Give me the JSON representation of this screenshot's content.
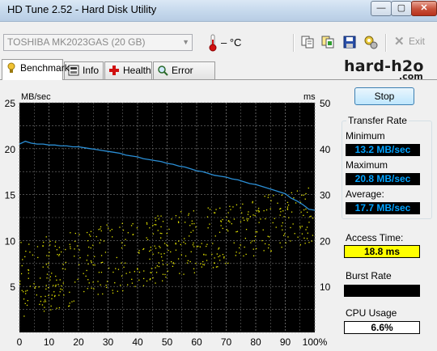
{
  "window": {
    "title": "HD Tune 2.52 - Hard Disk Utility",
    "min": "—",
    "max": "▢",
    "close": "✕"
  },
  "toolbar": {
    "drive": "TOSHIBA MK2023GAS (20 GB)",
    "temperature": "– °C",
    "exit": "Exit"
  },
  "tabs": [
    {
      "label": "Benchmark",
      "icon": "benchmark-icon"
    },
    {
      "label": "Info",
      "icon": "info-icon"
    },
    {
      "label": "Health",
      "icon": "health-icon"
    },
    {
      "label": "Error Scan",
      "icon": "error-scan-icon"
    }
  ],
  "logo": {
    "main": "hard-h2o",
    "sub": ".com"
  },
  "controls": {
    "stop": "Stop"
  },
  "stats": {
    "transfer_rate_title": "Transfer Rate",
    "minimum_label": "Minimum",
    "minimum_value": "13.2 MB/sec",
    "maximum_label": "Maximum",
    "maximum_value": "20.8 MB/sec",
    "average_label": "Average:",
    "average_value": "17.7 MB/sec",
    "access_time_label": "Access Time:",
    "access_time_value": "18.8 ms",
    "burst_rate_label": "Burst Rate",
    "burst_rate_value": "",
    "cpu_usage_label": "CPU Usage",
    "cpu_usage_value": "6.6%"
  },
  "chart_data": {
    "type": "line",
    "ylabel_left": "MB/sec",
    "ylabel_right": "ms",
    "x_ticks": [
      "0",
      "10",
      "20",
      "30",
      "40",
      "50",
      "60",
      "70",
      "80",
      "90",
      "100%"
    ],
    "ylim_left": [
      0,
      25
    ],
    "y_ticks_left": [
      "5",
      "10",
      "15",
      "20",
      "25"
    ],
    "ylim_right": [
      0,
      50
    ],
    "y_ticks_right": [
      "10",
      "20",
      "30",
      "40",
      "50"
    ],
    "grid": true,
    "background": "#000000",
    "series": [
      {
        "color": "#2b8fd6",
        "x": [
          0,
          2,
          4,
          6,
          8,
          10,
          12,
          14,
          16,
          18,
          20,
          22,
          24,
          26,
          28,
          30,
          32,
          34,
          36,
          38,
          40,
          42,
          44,
          46,
          48,
          50,
          52,
          54,
          56,
          58,
          60,
          62,
          64,
          66,
          68,
          70,
          72,
          74,
          76,
          78,
          80,
          82,
          84,
          86,
          88,
          90,
          92,
          94,
          96,
          98,
          100
        ],
        "y": [
          20.5,
          20.8,
          20.6,
          20.5,
          20.5,
          20.4,
          20.4,
          20.3,
          20.3,
          20.2,
          20.2,
          20.1,
          20.0,
          19.9,
          19.8,
          19.7,
          19.6,
          19.5,
          19.3,
          19.2,
          19.1,
          18.9,
          18.8,
          18.7,
          18.6,
          18.4,
          18.3,
          18.1,
          18.0,
          17.8,
          17.6,
          17.5,
          17.3,
          17.1,
          17.0,
          16.9,
          16.7,
          16.6,
          16.4,
          16.2,
          16.1,
          15.9,
          15.7,
          15.5,
          15.3,
          15.1,
          14.6,
          14.3,
          13.9,
          13.4,
          13.3
        ]
      }
    ],
    "access_time_scatter": {
      "color": "#e6e600",
      "ms_range_at_start": [
        3,
        20
      ],
      "ms_range_at_end": [
        20,
        32
      ]
    }
  }
}
